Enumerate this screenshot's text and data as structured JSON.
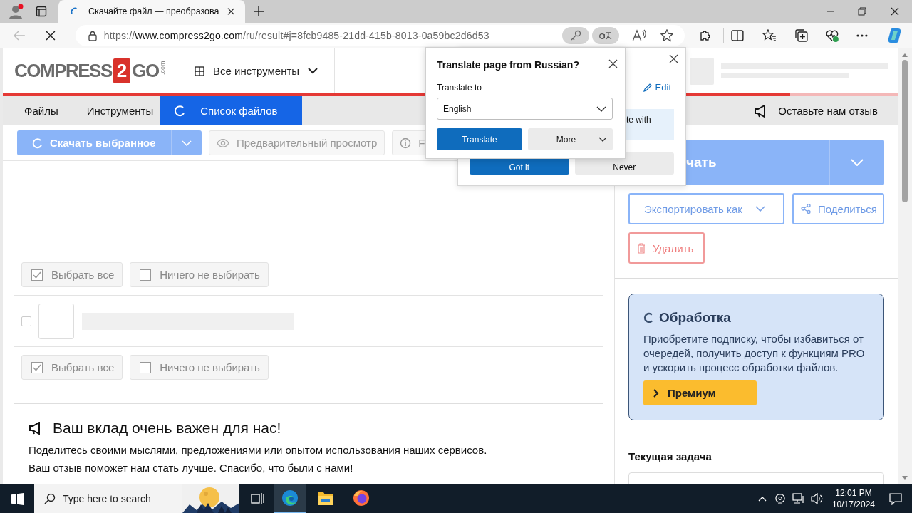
{
  "browser": {
    "tab_title": "Скачайте файл — преобразова",
    "url_scheme": "https://",
    "url_host": "www.compress2go.com",
    "url_path": "/ru/result#j=8fcb9485-21dd-415b-8013-0a59bc2d6d53"
  },
  "header": {
    "logo": {
      "word": "COMPRESS",
      "digit": "2",
      "tail": "GO",
      "suffix": ".com"
    },
    "tools_menu": "Все инструменты",
    "progress": {
      "level": 0.88
    }
  },
  "nav_tabs": [
    {
      "label": "Файлы",
      "selected": false
    },
    {
      "label": "Инструменты",
      "selected": false
    },
    {
      "label": "Список файлов",
      "selected": true
    }
  ],
  "feedback_link": "Оставьте нам отзыв",
  "toolbar": [
    {
      "kind": "download",
      "label": "Скачать выбранное"
    },
    {
      "kind": "preview",
      "label": "Предварительный просмотр"
    },
    {
      "kind": "info",
      "label": "F"
    }
  ],
  "file_list": {
    "select_bars": [
      {
        "options": [
          {
            "label": "Выбрать все",
            "checked": true
          },
          {
            "label": "Ничего не выбирать",
            "checked": false
          }
        ]
      },
      {
        "options": [
          {
            "label": "Выбрать все",
            "checked": true
          },
          {
            "label": "Ничего не выбирать",
            "checked": false
          }
        ]
      }
    ],
    "files": [
      {
        "checked": false
      }
    ]
  },
  "feedback_card": {
    "title": "Ваш вклад очень важен для нас!",
    "lines": [
      "Поделитесь своими мыслями, предложениями или опытом использования наших сервисов.",
      "Ваш отзыв поможет нам стать лучше. Спасибо, что были с нами!"
    ]
  },
  "sidebar": {
    "download_label": "чать",
    "export_label": "Экспортировать как",
    "share_label": "Поделиться",
    "delete_label": "Удалить",
    "processing": {
      "title": "Обработка",
      "text": "Приобретите подписку, чтобы избавиться от очередей, получить доступ к функциям PRO и ускорить процесс обработки файлов.",
      "button": "Премиум"
    },
    "current_task": "Текущая задача"
  },
  "tip_popup": {
    "edit": "Edit",
    "text": "te with",
    "primary": "Got it",
    "secondary": "Never"
  },
  "translate_popup": {
    "title": "Translate page from Russian?",
    "label": "Translate to",
    "language": "English",
    "translate": "Translate",
    "more": "More"
  },
  "taskbar": {
    "search_placeholder": "Type here to search",
    "apps": [
      {
        "kind": "edge",
        "selected": true
      },
      {
        "kind": "explorer",
        "selected": false
      },
      {
        "kind": "firefox",
        "selected": false
      }
    ],
    "time": "12:01 PM",
    "date": "10/17/2024"
  }
}
